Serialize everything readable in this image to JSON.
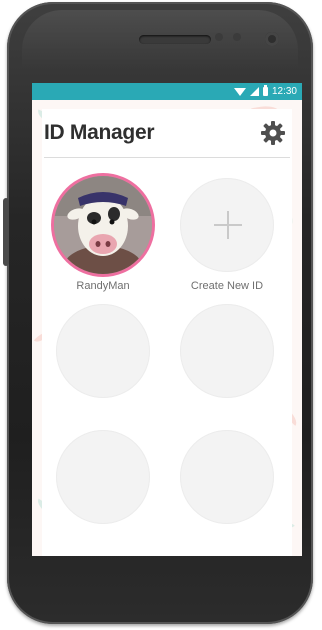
{
  "status_bar": {
    "time": "12:30",
    "icons": [
      "wifi-icon",
      "cellular-signal-icon",
      "battery-icon"
    ],
    "color": "#2aa9b5"
  },
  "header": {
    "title": "ID Manager",
    "settings_icon": "gear-icon"
  },
  "profiles": [
    {
      "label": "RandyMan",
      "type": "avatar",
      "accent": "#ee6fa0"
    },
    {
      "label": "Create New ID",
      "type": "create",
      "icon": "plus-icon"
    },
    {
      "label": "",
      "type": "empty"
    },
    {
      "label": "",
      "type": "empty"
    },
    {
      "label": "",
      "type": "empty"
    },
    {
      "label": "",
      "type": "empty"
    }
  ]
}
